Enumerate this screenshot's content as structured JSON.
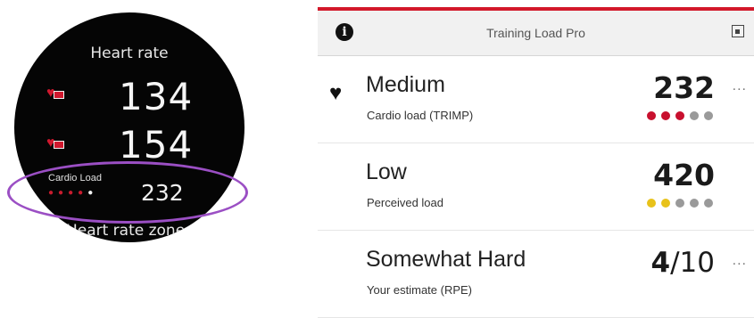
{
  "watch": {
    "title": "Heart rate",
    "hr_values": [
      "134",
      "154"
    ],
    "cardio_label": "Cardio Load",
    "cardio_value": "232",
    "cardio_dots": [
      "#c81c2e",
      "#c81c2e",
      "#c81c2e",
      "#c81c2e",
      "#f2f2f2"
    ],
    "zones_label": "Heart rate zones",
    "highlight_color": "#9b4fc4"
  },
  "app": {
    "accent_color": "#d3192b",
    "header": {
      "title": "Training Load Pro",
      "left_icon": "info-icon",
      "right_icon": "export-icon"
    },
    "rows": [
      {
        "name": "Medium",
        "subtitle": "Cardio load (TRIMP)",
        "value_bold": "232",
        "value_rest": "",
        "more": "...",
        "icon": "heart-icon",
        "level": 3,
        "level_max": 5,
        "dots": [
          "#c8102e",
          "#c8102e",
          "#c8102e",
          "#9a9a9a",
          "#9a9a9a"
        ]
      },
      {
        "name": "Low",
        "subtitle": "Perceived load",
        "value_bold": "420",
        "value_rest": "",
        "more": "",
        "level": 2,
        "level_max": 5,
        "dots": [
          "#e8c21a",
          "#e8c21a",
          "#9a9a9a",
          "#9a9a9a",
          "#9a9a9a"
        ]
      },
      {
        "name": "Somewhat Hard",
        "subtitle": "Your estimate (RPE)",
        "value_bold": "4",
        "value_rest": "/10",
        "more": "..."
      }
    ]
  }
}
